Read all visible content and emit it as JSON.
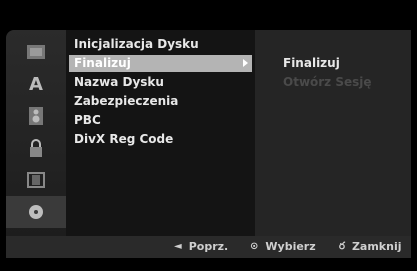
{
  "rail": {
    "icons": [
      {
        "name": "disc-setup-icon"
      },
      {
        "name": "language-icon",
        "glyph": "A"
      },
      {
        "name": "audio-speaker-icon"
      },
      {
        "name": "lock-icon"
      },
      {
        "name": "film-record-icon"
      },
      {
        "name": "disc-icon"
      }
    ]
  },
  "menu": {
    "items": [
      {
        "label": "Inicjalizacja Dysku"
      },
      {
        "label": "Finalizuj"
      },
      {
        "label": "Nazwa Dysku"
      },
      {
        "label": "Zabezpieczenia"
      },
      {
        "label": "PBC"
      },
      {
        "label": "DivX Reg Code"
      }
    ],
    "selected_label": "Finalizuj"
  },
  "submenu": {
    "items": [
      {
        "label": "Finalizuj"
      },
      {
        "label": "Otwórz Sesję"
      }
    ]
  },
  "helpbar": {
    "back": {
      "glyph": "◄",
      "label": "Poprz."
    },
    "select": {
      "glyph": "⊙",
      "label": "Wybierz"
    },
    "close": {
      "glyph": "ర",
      "label": "Zamknij"
    }
  },
  "colors": {
    "selected_bg": "#b4b4b4",
    "disabled_text": "#4a4a4a"
  }
}
